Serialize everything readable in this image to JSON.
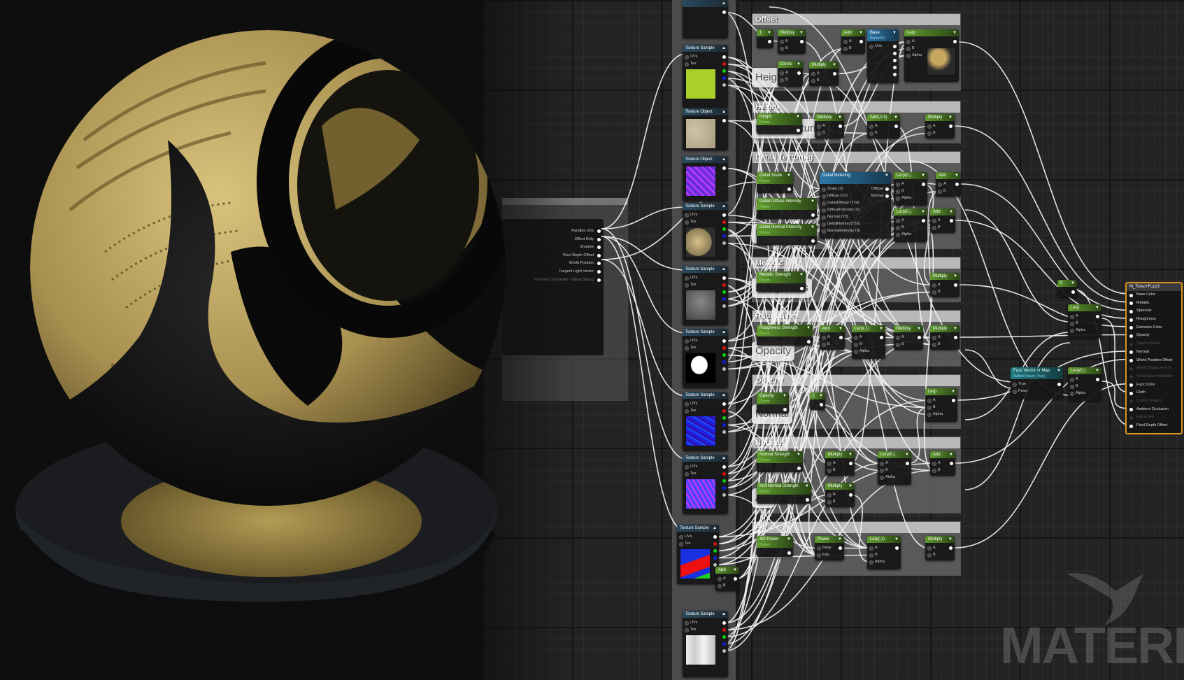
{
  "colors": {
    "accent": "#d8961c",
    "param_header": "#5f9a2e",
    "function_header": "#2d78a8",
    "switch_header": "#1d7b80",
    "wire": "#ffffff",
    "gold": "#c4ac62"
  },
  "parallax_node": {
    "outputs": [
      "Parallax UVs",
      "Offset Only",
      "Shadow",
      "Pixel Depth Offset",
      "World Position",
      "Tangent Light Vector",
      "Material Complexity - Steps Debug"
    ]
  },
  "texture_column": [
    {
      "title": "",
      "kind": "tex",
      "preview": "none"
    },
    {
      "title": "Texture Sample",
      "kind": "tex",
      "inputs": [
        "UVs",
        "Tex"
      ],
      "preview": "lime"
    },
    {
      "title": "Texture Object",
      "kind": "tex",
      "inputs": [],
      "preview": "beige"
    },
    {
      "title": "Texture Object",
      "kind": "tex",
      "inputs": [],
      "preview": "purple"
    },
    {
      "title": "Texture Sample",
      "kind": "tex",
      "inputs": [
        "UVs",
        "Tex"
      ],
      "preview": "beige2"
    },
    {
      "title": "Texture Sample",
      "kind": "tex",
      "inputs": [
        "UVs",
        "Tex"
      ],
      "preview": "gray"
    },
    {
      "title": "Texture Sample",
      "kind": "tex",
      "inputs": [
        "UVs",
        "Tex"
      ],
      "preview": "mask"
    },
    {
      "title": "Texture Sample",
      "kind": "tex",
      "inputs": [
        "UVs",
        "Tex"
      ],
      "preview": "blue"
    },
    {
      "title": "Texture Sample",
      "kind": "tex",
      "inputs": [
        "UVs",
        "Tex"
      ],
      "preview": "purplenoise"
    },
    {
      "title": "Texture Sample",
      "kind": "tex",
      "inputs": [
        "UVs",
        "Tex"
      ],
      "preview": "redblue"
    },
    {
      "title": "Add",
      "kind": "math",
      "inputs": [
        "A",
        "B"
      ],
      "outputs": [
        ""
      ]
    },
    {
      "title": "Texture Sample",
      "kind": "tex",
      "inputs": [
        "UVs",
        "Tex"
      ],
      "preview": "white"
    }
  ],
  "bubbles": [
    "Height",
    "Detail Texturing",
    "Metallic",
    "Roughness",
    "Opacity",
    "Normal",
    "AO"
  ],
  "groups": [
    {
      "title": "Offset",
      "nodes": [
        {
          "title": "1",
          "kind": "math",
          "inputs": [],
          "outputs": [
            ""
          ]
        },
        {
          "title": "Multiply",
          "kind": "math",
          "inputs": [
            "A",
            "B"
          ],
          "outputs": [
            ""
          ]
        },
        {
          "title": "Divide",
          "kind": "math",
          "inputs": [
            "A",
            "B"
          ],
          "outputs": [
            ""
          ]
        },
        {
          "title": "Multiply",
          "kind": "math",
          "inputs": [
            "A",
            "B"
          ],
          "outputs": [
            ""
          ]
        },
        {
          "title": "Add",
          "kind": "math",
          "inputs": [
            "A",
            "B"
          ],
          "outputs": [
            ""
          ]
        },
        {
          "title": "Base",
          "subtitle": "Param2D",
          "kind": "func",
          "inputs": [
            "UVs"
          ],
          "outputs": [
            "",
            "",
            "",
            "",
            ""
          ]
        },
        {
          "title": "Lerp",
          "kind": "math",
          "inputs": [
            "A",
            "B",
            "Alpha"
          ],
          "outputs": [
            ""
          ],
          "preview": "goldnoise"
        }
      ]
    },
    {
      "title": "Height",
      "nodes": [
        {
          "title": "Height",
          "subtitle": "Param",
          "kind": "param",
          "inputs": [],
          "outputs": [
            ""
          ]
        },
        {
          "title": "Multiply",
          "kind": "math",
          "inputs": [
            "A",
            "B"
          ],
          "outputs": [
            ""
          ]
        },
        {
          "title": "Add(,0.5)",
          "kind": "math",
          "inputs": [
            "A",
            "B"
          ],
          "outputs": [
            ""
          ]
        },
        {
          "title": "Multiply",
          "kind": "math",
          "inputs": [
            "A",
            "B"
          ],
          "outputs": [
            ""
          ]
        }
      ]
    },
    {
      "title": "Detail Texturing",
      "nodes": [
        {
          "title": "Detail Scale",
          "subtitle": "Param",
          "kind": "param",
          "inputs": [],
          "outputs": [
            ""
          ]
        },
        {
          "title": "Detail Diffuse Intensity",
          "subtitle": "Param",
          "kind": "param",
          "inputs": [],
          "outputs": [
            ""
          ]
        },
        {
          "title": "Detail Normal Intensity",
          "subtitle": "Param",
          "kind": "param",
          "inputs": [],
          "outputs": [
            ""
          ]
        },
        {
          "title": "DetailTexturing",
          "kind": "func",
          "inputs": [
            "Scale (S)",
            "Diffuse (V3)",
            "DetailDiffuse (T2d)",
            "DiffuseIntensity (S)",
            "Normal (V3)",
            "DetailNormal (T2d)",
            "NormalIntensity (S)"
          ],
          "outputs": [
            "Diffuse",
            "Normal"
          ]
        },
        {
          "title": "Lerp(0,)",
          "kind": "math",
          "inputs": [
            "A",
            "B",
            "Alpha"
          ],
          "outputs": [
            ""
          ]
        },
        {
          "title": "Lerp(0,)",
          "kind": "math",
          "inputs": [
            "A",
            "B",
            "Alpha"
          ],
          "outputs": [
            ""
          ]
        },
        {
          "title": "Add",
          "kind": "math",
          "inputs": [
            "A",
            "B"
          ],
          "outputs": [
            ""
          ]
        },
        {
          "title": "Add",
          "kind": "math",
          "inputs": [
            "A",
            "B"
          ],
          "outputs": [
            ""
          ]
        }
      ]
    },
    {
      "title": "Metallic",
      "nodes": [
        {
          "title": "Metallic Strength",
          "subtitle": "Param",
          "kind": "param",
          "inputs": [],
          "outputs": [
            ""
          ]
        },
        {
          "title": "Multiply",
          "kind": "math",
          "inputs": [
            "A",
            "B"
          ],
          "outputs": [
            ""
          ]
        }
      ]
    },
    {
      "title": "Roughness",
      "nodes": [
        {
          "title": "Roughness Strength",
          "subtitle": "Param",
          "kind": "param",
          "inputs": [],
          "outputs": [
            ""
          ]
        },
        {
          "title": "Add",
          "kind": "math",
          "inputs": [
            "A",
            "B"
          ],
          "outputs": [
            ""
          ]
        },
        {
          "title": "Lerp(,1)",
          "kind": "math",
          "inputs": [
            "A",
            "B",
            "Alpha"
          ],
          "outputs": [
            ""
          ]
        },
        {
          "title": "Multiply",
          "kind": "math",
          "inputs": [
            "A",
            "B"
          ],
          "outputs": [
            ""
          ]
        },
        {
          "title": "Multiply",
          "kind": "math",
          "inputs": [
            "A",
            "B"
          ],
          "outputs": [
            ""
          ]
        }
      ]
    },
    {
      "title": "Opacity",
      "nodes": [
        {
          "title": "Opacity",
          "subtitle": "Param",
          "kind": "param",
          "inputs": [],
          "outputs": [
            ""
          ]
        },
        {
          "title": "1",
          "kind": "math",
          "inputs": [],
          "outputs": [
            ""
          ]
        },
        {
          "title": "Lerp",
          "kind": "math",
          "inputs": [
            "A",
            "B",
            "Alpha"
          ],
          "outputs": [
            ""
          ]
        }
      ]
    },
    {
      "title": "Normal",
      "nodes": [
        {
          "title": "Normal Strength",
          "subtitle": "Param",
          "kind": "param",
          "inputs": [],
          "outputs": [
            ""
          ]
        },
        {
          "title": "Knit Normal Strength",
          "subtitle": "Param",
          "kind": "param",
          "inputs": [],
          "outputs": [
            ""
          ]
        },
        {
          "title": "Multiply",
          "kind": "math",
          "inputs": [
            "A",
            "B"
          ],
          "outputs": [
            ""
          ]
        },
        {
          "title": "Multiply",
          "kind": "math",
          "inputs": [
            "A",
            "B"
          ],
          "outputs": [
            ""
          ]
        },
        {
          "title": "Lerp(0,)",
          "kind": "math",
          "inputs": [
            "A",
            "B",
            "Alpha"
          ],
          "outputs": [
            ""
          ]
        },
        {
          "title": "Add",
          "kind": "math",
          "inputs": [
            "A",
            "B"
          ],
          "outputs": [
            ""
          ]
        }
      ]
    },
    {
      "title": "AO",
      "nodes": [
        {
          "title": "AO Power",
          "subtitle": "Param",
          "kind": "param",
          "inputs": [],
          "outputs": [
            ""
          ]
        },
        {
          "title": "Power",
          "kind": "math",
          "inputs": [
            "Base",
            "Exp"
          ],
          "outputs": [
            ""
          ]
        },
        {
          "title": "Lerp(,1)",
          "kind": "math",
          "inputs": [
            "A",
            "B",
            "Alpha"
          ],
          "outputs": [
            ""
          ]
        },
        {
          "title": "Multiply",
          "kind": "math",
          "inputs": [
            "A",
            "B"
          ],
          "outputs": [
            ""
          ]
        }
      ]
    }
  ],
  "free_nodes": [
    {
      "title": "0",
      "kind": "math",
      "inputs": [],
      "outputs": [
        ""
      ]
    },
    {
      "title": "Lerp",
      "kind": "math",
      "inputs": [
        "A",
        "B",
        "Alpha"
      ],
      "outputs": [
        ""
      ]
    },
    {
      "title": "Fuzz Vector or Map",
      "subtitle": "Switch Param (True)",
      "kind": "switch",
      "inputs": [
        "True",
        "False"
      ],
      "outputs": [
        ""
      ]
    },
    {
      "title": "Lerp(0,)",
      "kind": "math",
      "inputs": [
        "A",
        "B",
        "Alpha"
      ],
      "outputs": [
        ""
      ]
    }
  ],
  "material_node": {
    "title": "M_Torso+Fuzz3",
    "pins": [
      {
        "label": "Base Color",
        "enabled": true
      },
      {
        "label": "Metallic",
        "enabled": true
      },
      {
        "label": "Specular",
        "enabled": true
      },
      {
        "label": "Roughness",
        "enabled": true
      },
      {
        "label": "Emissive Color",
        "enabled": true
      },
      {
        "label": "Opacity",
        "enabled": true
      },
      {
        "label": "Opacity Mask",
        "enabled": false
      },
      {
        "label": "Normal",
        "enabled": true
      },
      {
        "label": "World Position Offset",
        "enabled": true
      },
      {
        "label": "World Displacement",
        "enabled": false
      },
      {
        "label": "Tessellation Multiplier",
        "enabled": false
      },
      {
        "label": "Fuzz Color",
        "enabled": true
      },
      {
        "label": "Cloth",
        "enabled": true
      },
      {
        "label": "Custom Data 1",
        "enabled": false
      },
      {
        "label": "Ambient Occlusion",
        "enabled": true
      },
      {
        "label": "Refraction",
        "enabled": false
      },
      {
        "label": "Pixel Depth Offset",
        "enabled": true
      }
    ]
  },
  "watermark": {
    "text": "MATERIA"
  }
}
